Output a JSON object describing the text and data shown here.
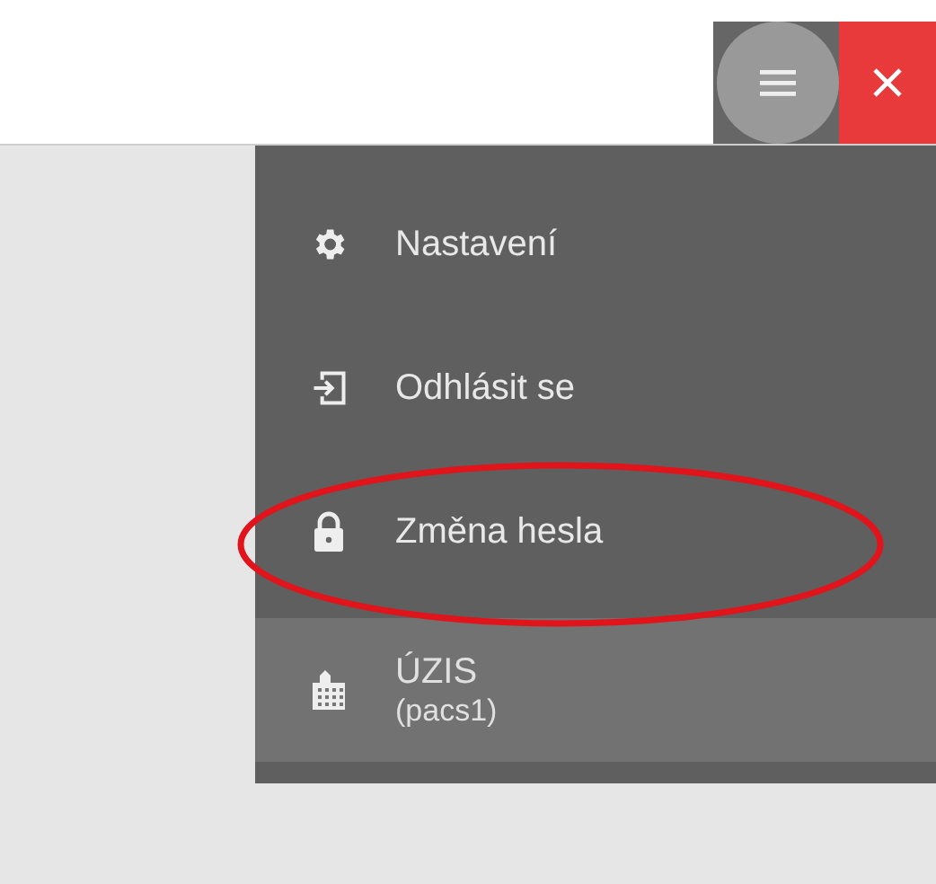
{
  "menu": {
    "items": [
      {
        "kind": "settings",
        "label": "Nastavení"
      },
      {
        "kind": "logout",
        "label": "Odhlásit se"
      },
      {
        "kind": "password",
        "label": "Změna hesla"
      }
    ],
    "organization": {
      "name": "ÚZIS",
      "code": "(pacs1)"
    }
  }
}
